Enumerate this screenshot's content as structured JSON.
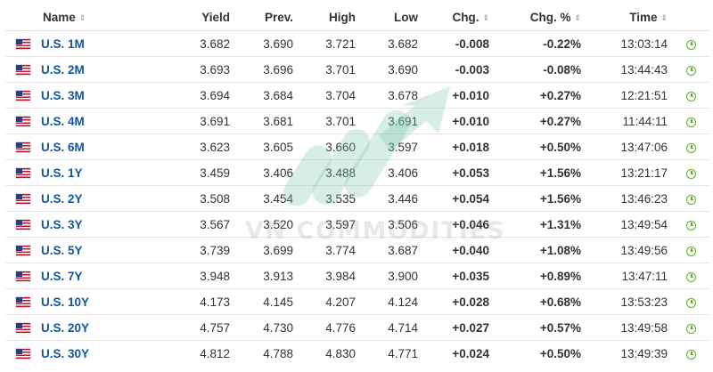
{
  "columns": {
    "name": "Name",
    "yield": "Yield",
    "prev": "Prev.",
    "high": "High",
    "low": "Low",
    "chg": "Chg.",
    "chg_pct": "Chg. %",
    "time": "Time"
  },
  "rows": [
    {
      "name": "U.S. 1M",
      "yield": "3.682",
      "prev": "3.690",
      "high": "3.721",
      "low": "3.682",
      "chg": "-0.008",
      "chg_pct": "-0.22%",
      "time": "13:03:14",
      "dir": "neg"
    },
    {
      "name": "U.S. 2M",
      "yield": "3.693",
      "prev": "3.696",
      "high": "3.701",
      "low": "3.690",
      "chg": "-0.003",
      "chg_pct": "-0.08%",
      "time": "13:44:43",
      "dir": "neg"
    },
    {
      "name": "U.S. 3M",
      "yield": "3.694",
      "prev": "3.684",
      "high": "3.704",
      "low": "3.678",
      "chg": "+0.010",
      "chg_pct": "+0.27%",
      "time": "12:21:51",
      "dir": "pos"
    },
    {
      "name": "U.S. 4M",
      "yield": "3.691",
      "prev": "3.681",
      "high": "3.701",
      "low": "3.691",
      "chg": "+0.010",
      "chg_pct": "+0.27%",
      "time": "11:44:11",
      "dir": "pos"
    },
    {
      "name": "U.S. 6M",
      "yield": "3.623",
      "prev": "3.605",
      "high": "3.660",
      "low": "3.597",
      "chg": "+0.018",
      "chg_pct": "+0.50%",
      "time": "13:47:06",
      "dir": "pos"
    },
    {
      "name": "U.S. 1Y",
      "yield": "3.459",
      "prev": "3.406",
      "high": "3.488",
      "low": "3.406",
      "chg": "+0.053",
      "chg_pct": "+1.56%",
      "time": "13:21:17",
      "dir": "pos"
    },
    {
      "name": "U.S. 2Y",
      "yield": "3.508",
      "prev": "3.454",
      "high": "3.535",
      "low": "3.446",
      "chg": "+0.054",
      "chg_pct": "+1.56%",
      "time": "13:46:23",
      "dir": "pos"
    },
    {
      "name": "U.S. 3Y",
      "yield": "3.567",
      "prev": "3.520",
      "high": "3.597",
      "low": "3.506",
      "chg": "+0.046",
      "chg_pct": "+1.31%",
      "time": "13:49:54",
      "dir": "pos"
    },
    {
      "name": "U.S. 5Y",
      "yield": "3.739",
      "prev": "3.699",
      "high": "3.774",
      "low": "3.687",
      "chg": "+0.040",
      "chg_pct": "+1.08%",
      "time": "13:49:56",
      "dir": "pos"
    },
    {
      "name": "U.S. 7Y",
      "yield": "3.948",
      "prev": "3.913",
      "high": "3.984",
      "low": "3.900",
      "chg": "+0.035",
      "chg_pct": "+0.89%",
      "time": "13:47:11",
      "dir": "pos"
    },
    {
      "name": "U.S. 10Y",
      "yield": "4.173",
      "prev": "4.145",
      "high": "4.207",
      "low": "4.124",
      "chg": "+0.028",
      "chg_pct": "+0.68%",
      "time": "13:53:23",
      "dir": "pos"
    },
    {
      "name": "U.S. 20Y",
      "yield": "4.757",
      "prev": "4.730",
      "high": "4.776",
      "low": "4.714",
      "chg": "+0.027",
      "chg_pct": "+0.57%",
      "time": "13:49:58",
      "dir": "pos"
    },
    {
      "name": "U.S. 30Y",
      "yield": "4.812",
      "prev": "4.788",
      "high": "4.830",
      "low": "4.771",
      "chg": "+0.024",
      "chg_pct": "+0.50%",
      "time": "13:49:39",
      "dir": "pos"
    }
  ],
  "icons": {
    "flag": "us-flag-icon",
    "time": "clock-icon",
    "sort": "sort-arrows-icon"
  },
  "colors": {
    "negative": "#e0161b",
    "positive": "#0ea600",
    "link": "#1256a0",
    "clock": "#5cae27"
  },
  "watermark": {
    "text": "VN COMMODITIES"
  }
}
